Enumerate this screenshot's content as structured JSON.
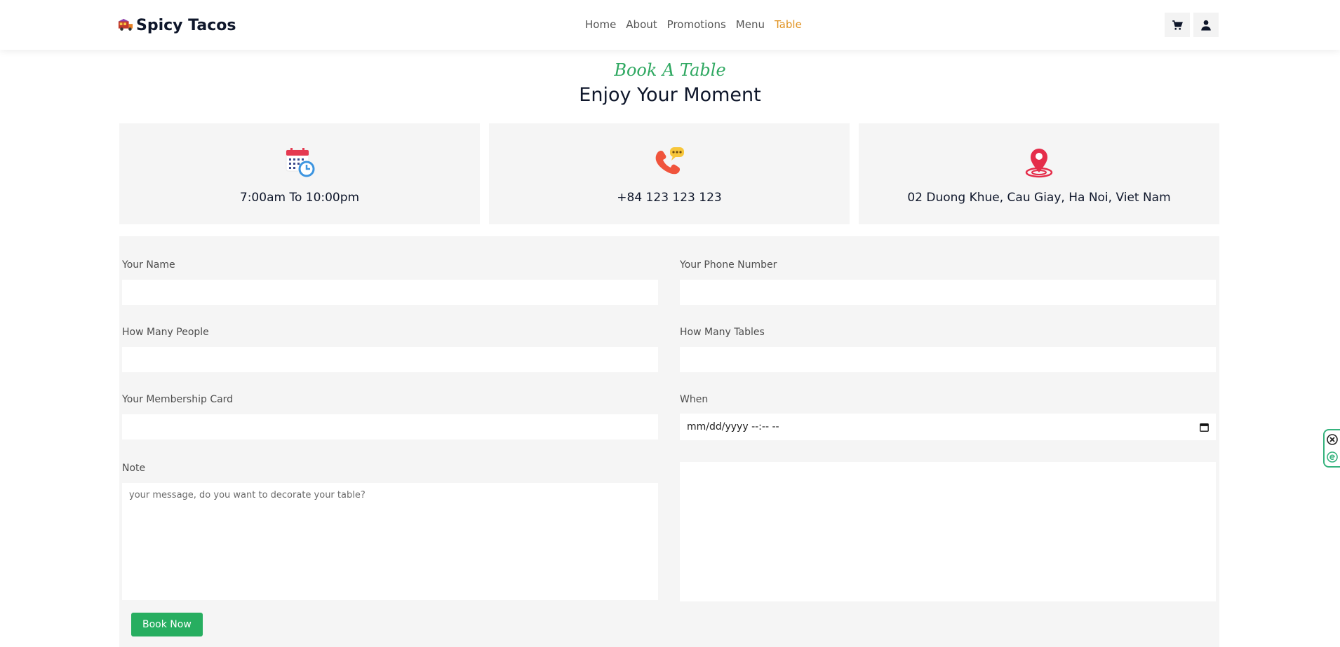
{
  "header": {
    "brand": "Spicy Tacos",
    "nav": [
      {
        "label": "Home"
      },
      {
        "label": "About"
      },
      {
        "label": "Promotions"
      },
      {
        "label": "Menu"
      },
      {
        "label": "Table",
        "active": true
      }
    ],
    "icons": [
      "cart-icon",
      "user-icon"
    ]
  },
  "hero": {
    "kicker": "Book A Table",
    "title": "Enjoy Your Moment"
  },
  "info": {
    "hours": "7:00am To 10:00pm",
    "phone": "+84 123 123 123",
    "address": "02 Duong Khue, Cau Giay, Ha Noi, Viet Nam"
  },
  "form": {
    "name_label": "Your Name",
    "phone_label": "Your Phone Number",
    "people_label": "How Many People",
    "tables_label": "How Many Tables",
    "membership_label": "Your Membership Card",
    "when_label": "When",
    "when_placeholder": "mm/dd/yyyy --:-- --",
    "note_label": "Note",
    "note_placeholder": "your message, do you want to decorate your table?",
    "submit_label": "Book Now"
  },
  "colors": {
    "accent_green": "#27ae60",
    "active_nav": "#e0911f",
    "dark_text": "#0f172b"
  }
}
